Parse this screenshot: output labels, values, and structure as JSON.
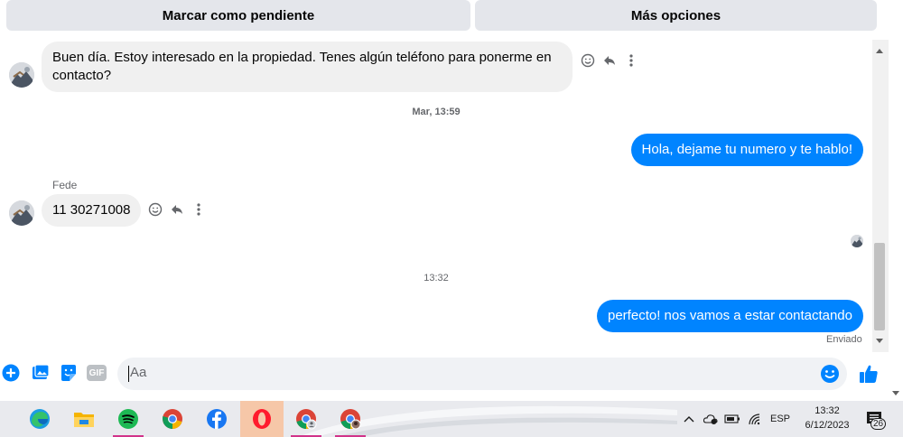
{
  "header": {
    "mark_pending_label": "Marcar como pendiente",
    "more_options_label": "Más opciones"
  },
  "conversation": {
    "first_message": "Buen día. Estoy interesado en la propiedad. Tenes algún teléfono para ponerme en contacto?",
    "timestamp_1": "Mar, 13:59",
    "reply_1": "Hola, dejame tu numero y te hablo!",
    "sender_name": "Fede",
    "phone_message": "11 30271008",
    "timestamp_2": "13:32",
    "reply_2": "perfecto! nos vamos a estar contactando",
    "delivery_status": "Enviado"
  },
  "composer": {
    "placeholder": "Aa",
    "gif_label": "GIF"
  },
  "taskbar": {
    "apps": [
      "edge",
      "file-explorer",
      "spotify",
      "chrome",
      "facebook",
      "opera",
      "chrome-profile-1",
      "chrome-profile-2"
    ],
    "active_app": "opera",
    "language": "ESP",
    "time": "13:32",
    "date": "6/12/2023",
    "notification_count": "26"
  },
  "colors": {
    "accent": "#0084ff",
    "incoming_bubble": "#f0f0f0",
    "button_bg": "#e4e6eb"
  }
}
